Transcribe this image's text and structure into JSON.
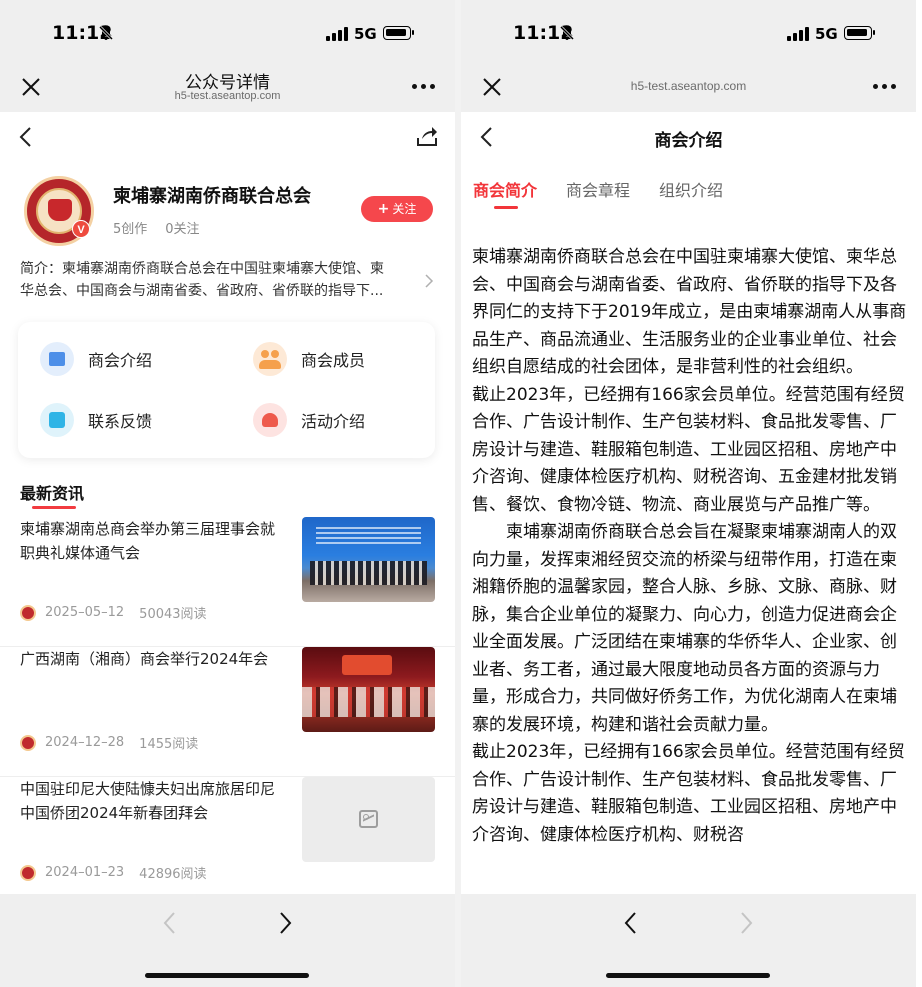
{
  "status": {
    "time": "11:12",
    "network": "5G"
  },
  "left": {
    "nav": {
      "title": "公众号详情",
      "url": "h5-test.aseantop.com"
    },
    "profile": {
      "name": "柬埔寨湖南侨商联合总会",
      "works": "5创作",
      "follows": "0关注",
      "follow_button": "关注",
      "follow_plus": "+",
      "verified_badge": "V"
    },
    "intro": {
      "line1": "简介：柬埔寨湖南侨商联合总会在中国驻柬埔寨大使馆、柬",
      "line2": "华总会、中国商会与湖南省委、省政府、省侨联的指导下..."
    },
    "menu": [
      {
        "label": "商会介绍",
        "icon": "building-icon"
      },
      {
        "label": "商会成员",
        "icon": "members-icon"
      },
      {
        "label": "联系反馈",
        "icon": "feedback-icon"
      },
      {
        "label": "活动介绍",
        "icon": "activity-icon"
      }
    ],
    "news_heading": "最新资讯",
    "news": [
      {
        "title": "柬埔寨湖南总商会举办第三届理事会就职典礼媒体通气会",
        "date": "2025–05–12",
        "views": "50043阅读"
      },
      {
        "title": "广西湖南（湘商）商会举行2024年会",
        "date": "2024–12–28",
        "views": "1455阅读"
      },
      {
        "title": "中国驻印尼大使陆慷夫妇出席旅居印尼中国侨团2024年新春团拜会",
        "date": "2024–01–23",
        "views": "42896阅读"
      }
    ]
  },
  "right": {
    "nav": {
      "url": "h5-test.aseantop.com"
    },
    "page_title": "商会介绍",
    "tabs": [
      {
        "label": "商会简介",
        "active": true
      },
      {
        "label": "商会章程",
        "active": false
      },
      {
        "label": "组织介绍",
        "active": false
      }
    ],
    "article": [
      "柬埔寨湖南侨商联合总会在中国驻柬埔寨大使馆、柬华总会、中国商会与湖南省委、省政府、省侨联的指导下及各界同仁的支持下于2019年成立，是由柬埔寨湖南人从事商品生产、商品流通业、生活服务业的企业事业单位、社会组织自愿结成的社会团体，是非营利性的社会组织。",
      "截止2023年，已经拥有166家会员单位。经营范围有经贸合作、广告设计制作、生产包装材料、食品批发零售、厂房设计与建造、鞋服箱包制造、工业园区招租、房地产中介咨询、健康体检医疗机构、财税咨询、五金建材批发销售、餐饮、食物冷链、物流、商业展览与产品推广等。",
      "柬埔寨湖南侨商联合总会旨在凝聚柬埔寨湖南人的双向力量，发挥柬湘经贸交流的桥梁与纽带作用，打造在柬湘籍侨胞的温馨家园，整合人脉、乡脉、文脉、商脉、财脉，集合企业单位的凝聚力、向心力，创造力促进商会企业全面发展。广泛团结在柬埔寨的华侨华人、企业家、创业者、务工者，通过最大限度地动员各方面的资源与力量，形成合力，共同做好侨务工作，为优化湖南人在柬埔寨的发展环境，构建和谐社会贡献力量。",
      "截止2023年，已经拥有166家会员单位。经营范围有经贸合作、广告设计制作、生产包装材料、食品批发零售、厂房设计与建造、鞋服箱包制造、工业园区招租、房地产中介咨询、健康体检医疗机构、财税咨"
    ]
  }
}
